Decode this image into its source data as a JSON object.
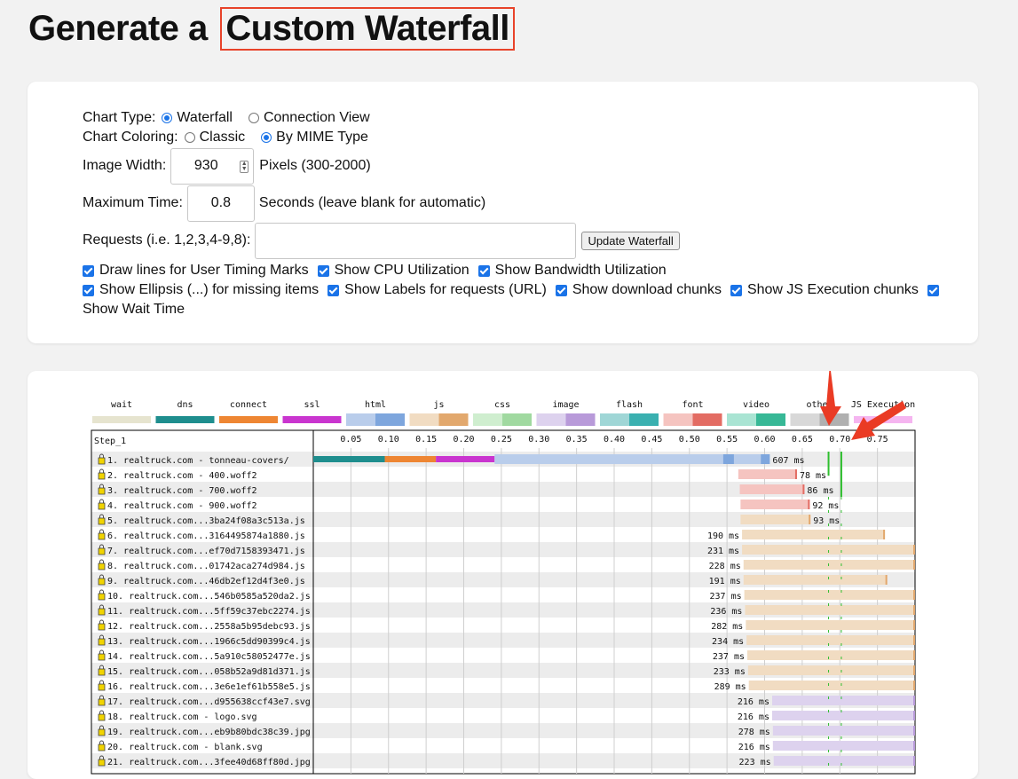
{
  "header": {
    "title_prefix": "Generate a",
    "title_highlight": "Custom Waterfall"
  },
  "form": {
    "chart_type_label": "Chart Type:",
    "chart_type_options": [
      {
        "label": "Waterfall",
        "selected": true
      },
      {
        "label": "Connection View",
        "selected": false
      }
    ],
    "chart_coloring_label": "Chart Coloring:",
    "chart_coloring_options": [
      {
        "label": "Classic",
        "selected": false
      },
      {
        "label": "By MIME Type",
        "selected": true
      }
    ],
    "image_width_label": "Image Width:",
    "image_width_value": "930",
    "image_width_suffix": "Pixels (300-2000)",
    "max_time_label": "Maximum Time:",
    "max_time_value": "0.8",
    "max_time_suffix": "Seconds (leave blank for automatic)",
    "requests_label": "Requests (i.e. 1,2,3,4-9,8):",
    "requests_value": "",
    "update_button": "Update Waterfall",
    "checkboxes": [
      "Draw lines for User Timing Marks",
      "Show CPU Utilization",
      "Show Bandwidth Utilization",
      "Show Ellipsis (...) for missing items",
      "Show Labels for requests (URL)",
      "Show download chunks",
      "Show JS Execution chunks",
      "Show Wait Time"
    ]
  },
  "waterfall": {
    "legend": [
      {
        "name": "wait",
        "color": "#e6e4cf",
        "dark": "#f0efe3"
      },
      {
        "name": "dns",
        "color": "#1f8e8e",
        "dark": "#2a7f7f"
      },
      {
        "name": "connect",
        "color": "#ee8633",
        "dark": "#e07a25"
      },
      {
        "name": "ssl",
        "color": "#c935cf",
        "dark": "#b52bbb"
      },
      {
        "name": "html",
        "color": "#b9cdeb",
        "dark": "#7ea6dd"
      },
      {
        "name": "js",
        "color": "#f1dcc2",
        "dark": "#e2a86d"
      },
      {
        "name": "css",
        "color": "#cfeecf",
        "dark": "#a0d9a0"
      },
      {
        "name": "image",
        "color": "#ddd2ee",
        "dark": "#b89ad9"
      },
      {
        "name": "flash",
        "color": "#9fd6d6",
        "dark": "#3ab0b0"
      },
      {
        "name": "font",
        "color": "#f5c4c0",
        "dark": "#e36c63"
      },
      {
        "name": "video",
        "color": "#a9e4d3",
        "dark": "#37b896"
      },
      {
        "name": "other",
        "color": "#d8d8d8",
        "dark": "#b0b0b0"
      },
      {
        "name": "JS Execution",
        "color": "#f5b5f0",
        "dark": "#f5b5f0"
      }
    ],
    "step_label": "Step_1",
    "ticks": [
      "0.05",
      "0.10",
      "0.15",
      "0.20",
      "0.25",
      "0.30",
      "0.35",
      "0.40",
      "0.45",
      "0.50",
      "0.55",
      "0.60",
      "0.65",
      "0.70",
      "0.75"
    ],
    "max_time": 0.8,
    "marks": [
      0.685,
      0.702
    ],
    "requests": [
      {
        "label": " 1. realtruck.com - tonneau-covers/",
        "type": "html",
        "start": 0.0,
        "dns": 0.095,
        "connect": 0.068,
        "ssl": 0.078,
        "dur_label": "607 ms",
        "end": 0.607,
        "label_pos": "right"
      },
      {
        "label": " 2. realtruck.com - 400.woff2",
        "type": "font",
        "start": 0.565,
        "end": 0.643,
        "dur_label": "78 ms",
        "label_pos": "right"
      },
      {
        "label": " 3. realtruck.com - 700.woff2",
        "type": "font",
        "start": 0.567,
        "end": 0.653,
        "dur_label": "86 ms",
        "label_pos": "right"
      },
      {
        "label": " 4. realtruck.com - 900.woff2",
        "type": "font",
        "start": 0.568,
        "end": 0.66,
        "dur_label": "92 ms",
        "label_pos": "right"
      },
      {
        "label": " 5. realtruck.com...3ba24f08a3c513a.js",
        "type": "js",
        "start": 0.568,
        "end": 0.661,
        "dur_label": "93 ms",
        "label_pos": "right"
      },
      {
        "label": " 6. realtruck.com...3164495874a1880.js",
        "type": "js",
        "start": 0.57,
        "end": 0.76,
        "dur_label": "190 ms",
        "label_pos": "left"
      },
      {
        "label": " 7. realtruck.com...ef70d7158393471.js",
        "type": "js",
        "start": 0.57,
        "end": 0.801,
        "dur_label": "231 ms",
        "label_pos": "left"
      },
      {
        "label": " 8. realtruck.com...01742aca274d984.js",
        "type": "js",
        "start": 0.572,
        "end": 0.8,
        "dur_label": "228 ms",
        "label_pos": "left"
      },
      {
        "label": " 9. realtruck.com...46db2ef12d4f3e0.js",
        "type": "js",
        "start": 0.572,
        "end": 0.763,
        "dur_label": "191 ms",
        "label_pos": "left"
      },
      {
        "label": "10. realtruck.com...546b0585a520da2.js",
        "type": "js",
        "start": 0.573,
        "end": 0.81,
        "dur_label": "237 ms",
        "label_pos": "left"
      },
      {
        "label": "11. realtruck.com...5ff59c37ebc2274.js",
        "type": "js",
        "start": 0.574,
        "end": 0.81,
        "dur_label": "236 ms",
        "label_pos": "left"
      },
      {
        "label": "12. realtruck.com...2558a5b95debc93.js",
        "type": "js",
        "start": 0.575,
        "end": 0.857,
        "dur_label": "282 ms",
        "label_pos": "left"
      },
      {
        "label": "13. realtruck.com...1966c5dd90399c4.js",
        "type": "js",
        "start": 0.576,
        "end": 0.81,
        "dur_label": "234 ms",
        "label_pos": "left"
      },
      {
        "label": "14. realtruck.com...5a910c58052477e.js",
        "type": "js",
        "start": 0.577,
        "end": 0.814,
        "dur_label": "237 ms",
        "label_pos": "left"
      },
      {
        "label": "15. realtruck.com...058b52a9d81d371.js",
        "type": "js",
        "start": 0.578,
        "end": 0.811,
        "dur_label": "233 ms",
        "label_pos": "left"
      },
      {
        "label": "16. realtruck.com...3e6e1ef61b558e5.js",
        "type": "js",
        "start": 0.579,
        "end": 0.868,
        "dur_label": "289 ms",
        "label_pos": "left"
      },
      {
        "label": "17. realtruck.com...d955638ccf43e7.svg",
        "type": "image",
        "start": 0.61,
        "end": 0.826,
        "dur_label": "216 ms",
        "label_pos": "left"
      },
      {
        "label": "18. realtruck.com - logo.svg",
        "type": "image",
        "start": 0.61,
        "end": 0.826,
        "dur_label": "216 ms",
        "label_pos": "left"
      },
      {
        "label": "19. realtruck.com...eb9b80bdc38c39.jpg",
        "type": "image",
        "start": 0.611,
        "end": 0.889,
        "dur_label": "278 ms",
        "label_pos": "left"
      },
      {
        "label": "20. realtruck.com - blank.svg",
        "type": "image",
        "start": 0.611,
        "end": 0.827,
        "dur_label": "216 ms",
        "label_pos": "left"
      },
      {
        "label": "21. realtruck.com...3fee40d68ff80d.jpg",
        "type": "image",
        "start": 0.612,
        "end": 0.835,
        "dur_label": "223 ms",
        "label_pos": "left"
      }
    ]
  }
}
